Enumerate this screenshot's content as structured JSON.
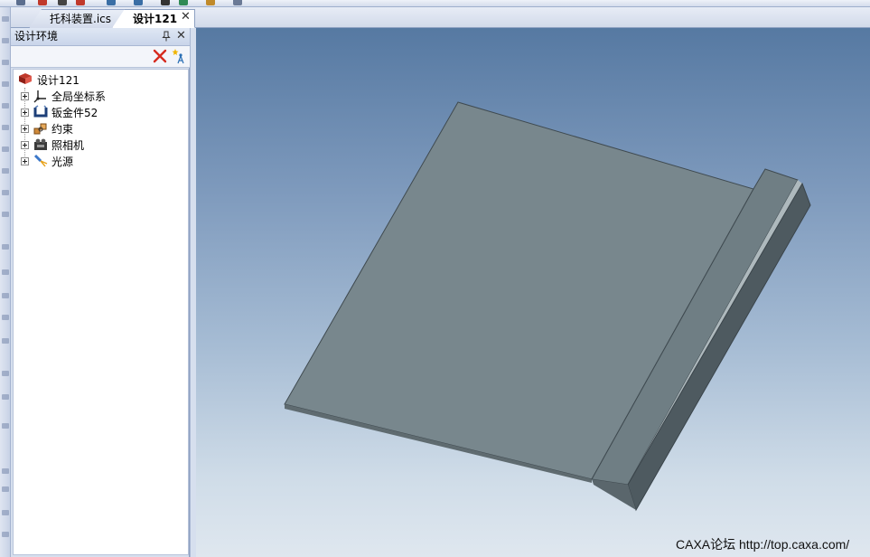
{
  "tabs": [
    {
      "label": "托科装置.ics",
      "active": false
    },
    {
      "label": "设计121",
      "active": true
    }
  ],
  "panel": {
    "title": "设计环境",
    "icons": [
      "pin-icon",
      "close-icon",
      "clear-filter-icon",
      "filter-star-icon"
    ]
  },
  "tree": {
    "root": {
      "label": "设计121",
      "icon": "design-icon"
    },
    "nodes": [
      {
        "label": "全局坐标系",
        "icon": "coordinate-system-icon"
      },
      {
        "label": "钣金件52",
        "icon": "sheet-metal-icon"
      },
      {
        "label": "约束",
        "icon": "constraint-icon"
      },
      {
        "label": "照相机",
        "icon": "camera-icon"
      },
      {
        "label": "光源",
        "icon": "light-source-icon"
      }
    ]
  },
  "viewport": {
    "background_top": "#5679a2",
    "background_bottom": "#dfe7ef",
    "part_color": "#78878d",
    "watermark": "CAXA论坛 http://top.caxa.com/"
  }
}
